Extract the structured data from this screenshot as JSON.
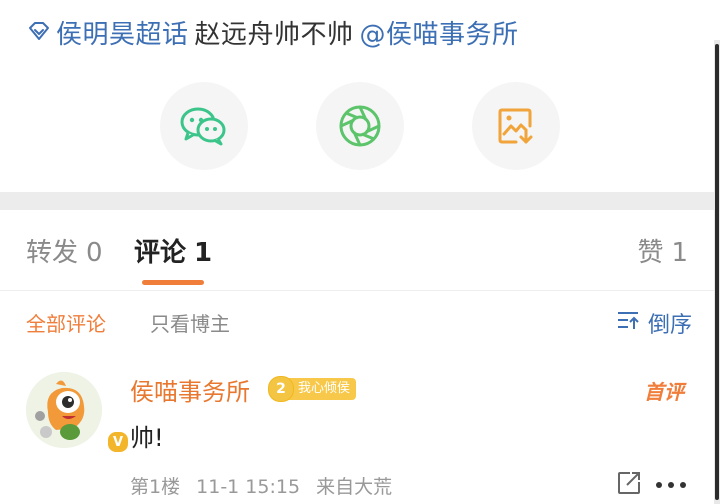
{
  "header": {
    "topic_link": "侯明昊超话",
    "post_text": "赵远舟帅不帅",
    "mention": "@侯喵事务所"
  },
  "share": {
    "buttons": [
      {
        "name": "wechat-icon"
      },
      {
        "name": "moments-icon"
      },
      {
        "name": "save-image-icon"
      }
    ]
  },
  "tabs": {
    "repost_label": "转发",
    "repost_count": "0",
    "comment_label": "评论",
    "comment_count": "1",
    "like_label": "赞",
    "like_count": "1"
  },
  "filters": {
    "all": "全部评论",
    "blogger_only": "只看博主",
    "sort": "倒序"
  },
  "comment": {
    "username": "侯喵事务所",
    "fan_level": "2",
    "fan_label": "我心倾侯",
    "first_tag": "首评",
    "text": "帅!",
    "floor": "第1楼",
    "time": "11-1 15:15",
    "source": "来自大荒",
    "verified": "V"
  },
  "colors": {
    "link": "#3d6fb4",
    "accent": "#f07d3a",
    "badge": "#f7c84a"
  }
}
